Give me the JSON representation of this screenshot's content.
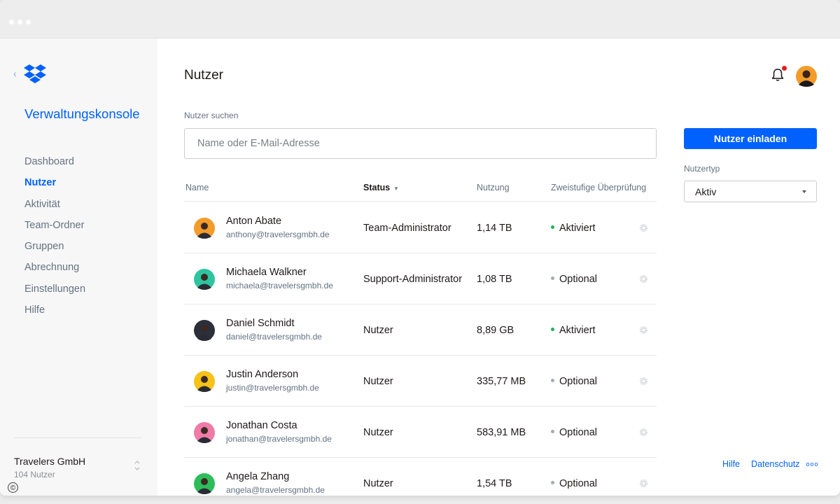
{
  "sidebar": {
    "console_title": "Verwaltungskonsole",
    "nav": [
      "Dashboard",
      "Nutzer",
      "Aktivität",
      "Team-Ordner",
      "Gruppen",
      "Abrechnung",
      "Einstellungen",
      "Hilfe"
    ],
    "active_item": "Nutzer",
    "team_name": "Travelers GmbH",
    "team_count": "104 Nutzer"
  },
  "header": {
    "title": "Nutzer",
    "notification": true
  },
  "search": {
    "label": "Nutzer suchen",
    "placeholder": "Name oder E-Mail-Adresse",
    "value": ""
  },
  "table": {
    "headers": {
      "name": "Name",
      "status": "Status",
      "usage": "Nutzung",
      "twofa": "Zweistufige Überprüfung"
    },
    "rows": [
      {
        "name": "Anton Abate",
        "email": "anthony@travelersgmbh.de",
        "role": "Team-Administrator",
        "usage": "1,14 TB",
        "twofa": "Aktiviert",
        "twofa_on": true,
        "avatar_color": "#f39c2a"
      },
      {
        "name": "Michaela Walkner",
        "email": "michaela@travelersgmbh.de",
        "role": "Support-Administrator",
        "usage": "1,08 TB",
        "twofa": "Optional",
        "twofa_on": false,
        "avatar_color": "#2ec4a0"
      },
      {
        "name": "Daniel Schmidt",
        "email": "daniel@travelersgmbh.de",
        "role": "Nutzer",
        "usage": "8,89 GB",
        "twofa": "Aktiviert",
        "twofa_on": true,
        "avatar_color": "#2b2f3a"
      },
      {
        "name": "Justin Anderson",
        "email": "justin@travelersgmbh.de",
        "role": "Nutzer",
        "usage": "335,77 MB",
        "twofa": "Optional",
        "twofa_on": false,
        "avatar_color": "#f5c217"
      },
      {
        "name": "Jonathan Costa",
        "email": "jonathan@travelersgmbh.de",
        "role": "Nutzer",
        "usage": "583,91 MB",
        "twofa": "Optional",
        "twofa_on": false,
        "avatar_color": "#f07aa8"
      },
      {
        "name": "Angela Zhang",
        "email": "angela@travelersgmbh.de",
        "role": "Nutzer",
        "usage": "1,54 TB",
        "twofa": "Optional",
        "twofa_on": false,
        "avatar_color": "#2ebd5a"
      }
    ]
  },
  "actions": {
    "invite_label": "Nutzer einladen",
    "type_label": "Nutzertyp",
    "type_value": "Aktiv"
  },
  "footer": {
    "help": "Hilfe",
    "privacy": "Datenschutz"
  },
  "colors": {
    "accent": "#0061fe",
    "enabled_dot": "#1fb35a",
    "optional_dot": "#a6abb0"
  }
}
